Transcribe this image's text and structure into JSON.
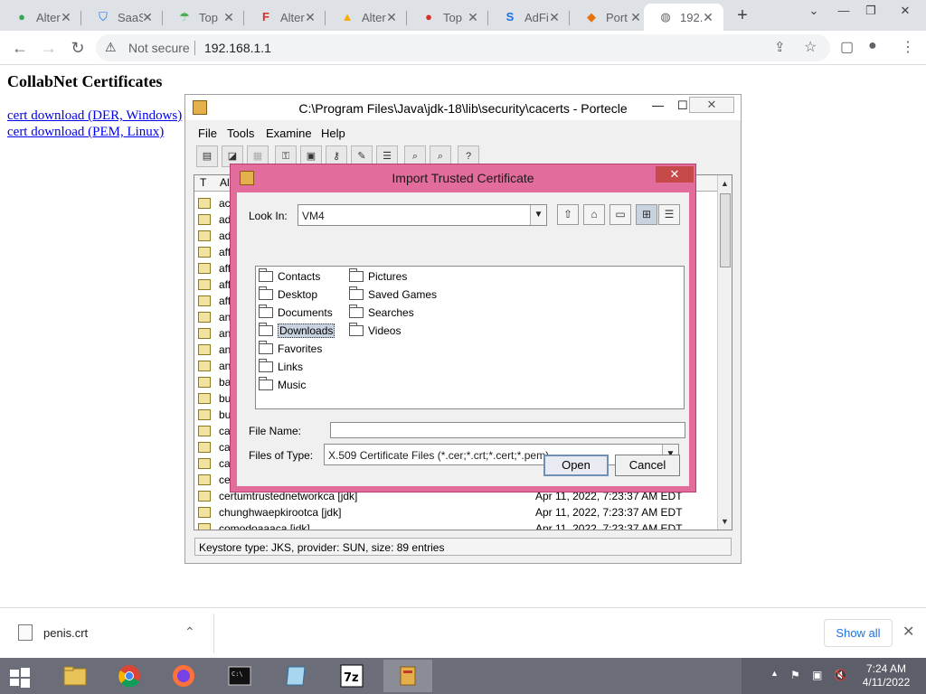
{
  "browser": {
    "tabs": [
      {
        "title": "Alter",
        "icon": "altered-icon"
      },
      {
        "title": "SaaS",
        "icon": "shield-icon"
      },
      {
        "title": "Top",
        "icon": "umbrella-icon"
      },
      {
        "title": "Alter",
        "icon": "af-icon"
      },
      {
        "title": "Alter",
        "icon": "warning-icon"
      },
      {
        "title": "Top",
        "icon": "apple-icon"
      },
      {
        "title": "AdFi",
        "icon": "s-icon"
      },
      {
        "title": "Port",
        "icon": "diamond-icon"
      },
      {
        "title": "192.",
        "icon": "globe-icon"
      }
    ],
    "omnibox": {
      "security": "Not secure",
      "url": "192.168.1.1"
    }
  },
  "page": {
    "title": "CollabNet Certificates",
    "links": [
      "cert download (DER, Windows)",
      "cert download (PEM, Linux)"
    ]
  },
  "portecle": {
    "title": "C:\\Program Files\\Java\\jdk-18\\lib\\security\\cacerts - Portecle",
    "menu": [
      "File",
      "Tools",
      "Examine",
      "Help"
    ],
    "columns": [
      "T",
      "Al"
    ],
    "rows": [
      {
        "alias": "ac",
        "date": ""
      },
      {
        "alias": "ad",
        "date": ""
      },
      {
        "alias": "ad",
        "date": ""
      },
      {
        "alias": "aff",
        "date": ""
      },
      {
        "alias": "aff",
        "date": ""
      },
      {
        "alias": "aff",
        "date": ""
      },
      {
        "alias": "aff",
        "date": ""
      },
      {
        "alias": "an",
        "date": ""
      },
      {
        "alias": "an",
        "date": ""
      },
      {
        "alias": "an",
        "date": ""
      },
      {
        "alias": "an",
        "date": ""
      },
      {
        "alias": "ba",
        "date": ""
      },
      {
        "alias": "bu",
        "date": ""
      },
      {
        "alias": "bu",
        "date": ""
      },
      {
        "alias": "ca",
        "date": ""
      },
      {
        "alias": "ca",
        "date": ""
      },
      {
        "alias": "ca",
        "date": ""
      },
      {
        "alias": "ce",
        "date": ""
      },
      {
        "alias": "certumtrustednetworkca [jdk]",
        "date": "Apr 11, 2022, 7:23:37 AM EDT"
      },
      {
        "alias": "chunghwaepkirootca [jdk]",
        "date": "Apr 11, 2022, 7:23:37 AM EDT"
      },
      {
        "alias": "comodoaaaca [jdk]",
        "date": "Apr 11, 2022, 7:23:37 AM EDT"
      }
    ],
    "status": "Keystore type: JKS, provider: SUN, size: 89 entries"
  },
  "dialog": {
    "title": "Import Trusted Certificate",
    "look_in_label": "Look In:",
    "look_in_value": "VM4",
    "folders_col1": [
      "Contacts",
      "Desktop",
      "Documents",
      "Downloads",
      "Favorites",
      "Links",
      "Music"
    ],
    "folders_col2": [
      "Pictures",
      "Saved Games",
      "Searches",
      "Videos"
    ],
    "selected_folder": "Downloads",
    "file_name_label": "File Name:",
    "file_name_value": "",
    "files_of_type_label": "Files of Type:",
    "files_of_type_value": "X.509 Certificate Files (*.cer;*.crt;*.cert;*.pem)",
    "open_label": "Open",
    "cancel_label": "Cancel"
  },
  "download_shelf": {
    "file": "penis.crt",
    "show_all": "Show all"
  },
  "taskbar": {
    "time": "7:24 AM",
    "date": "4/11/2022"
  }
}
